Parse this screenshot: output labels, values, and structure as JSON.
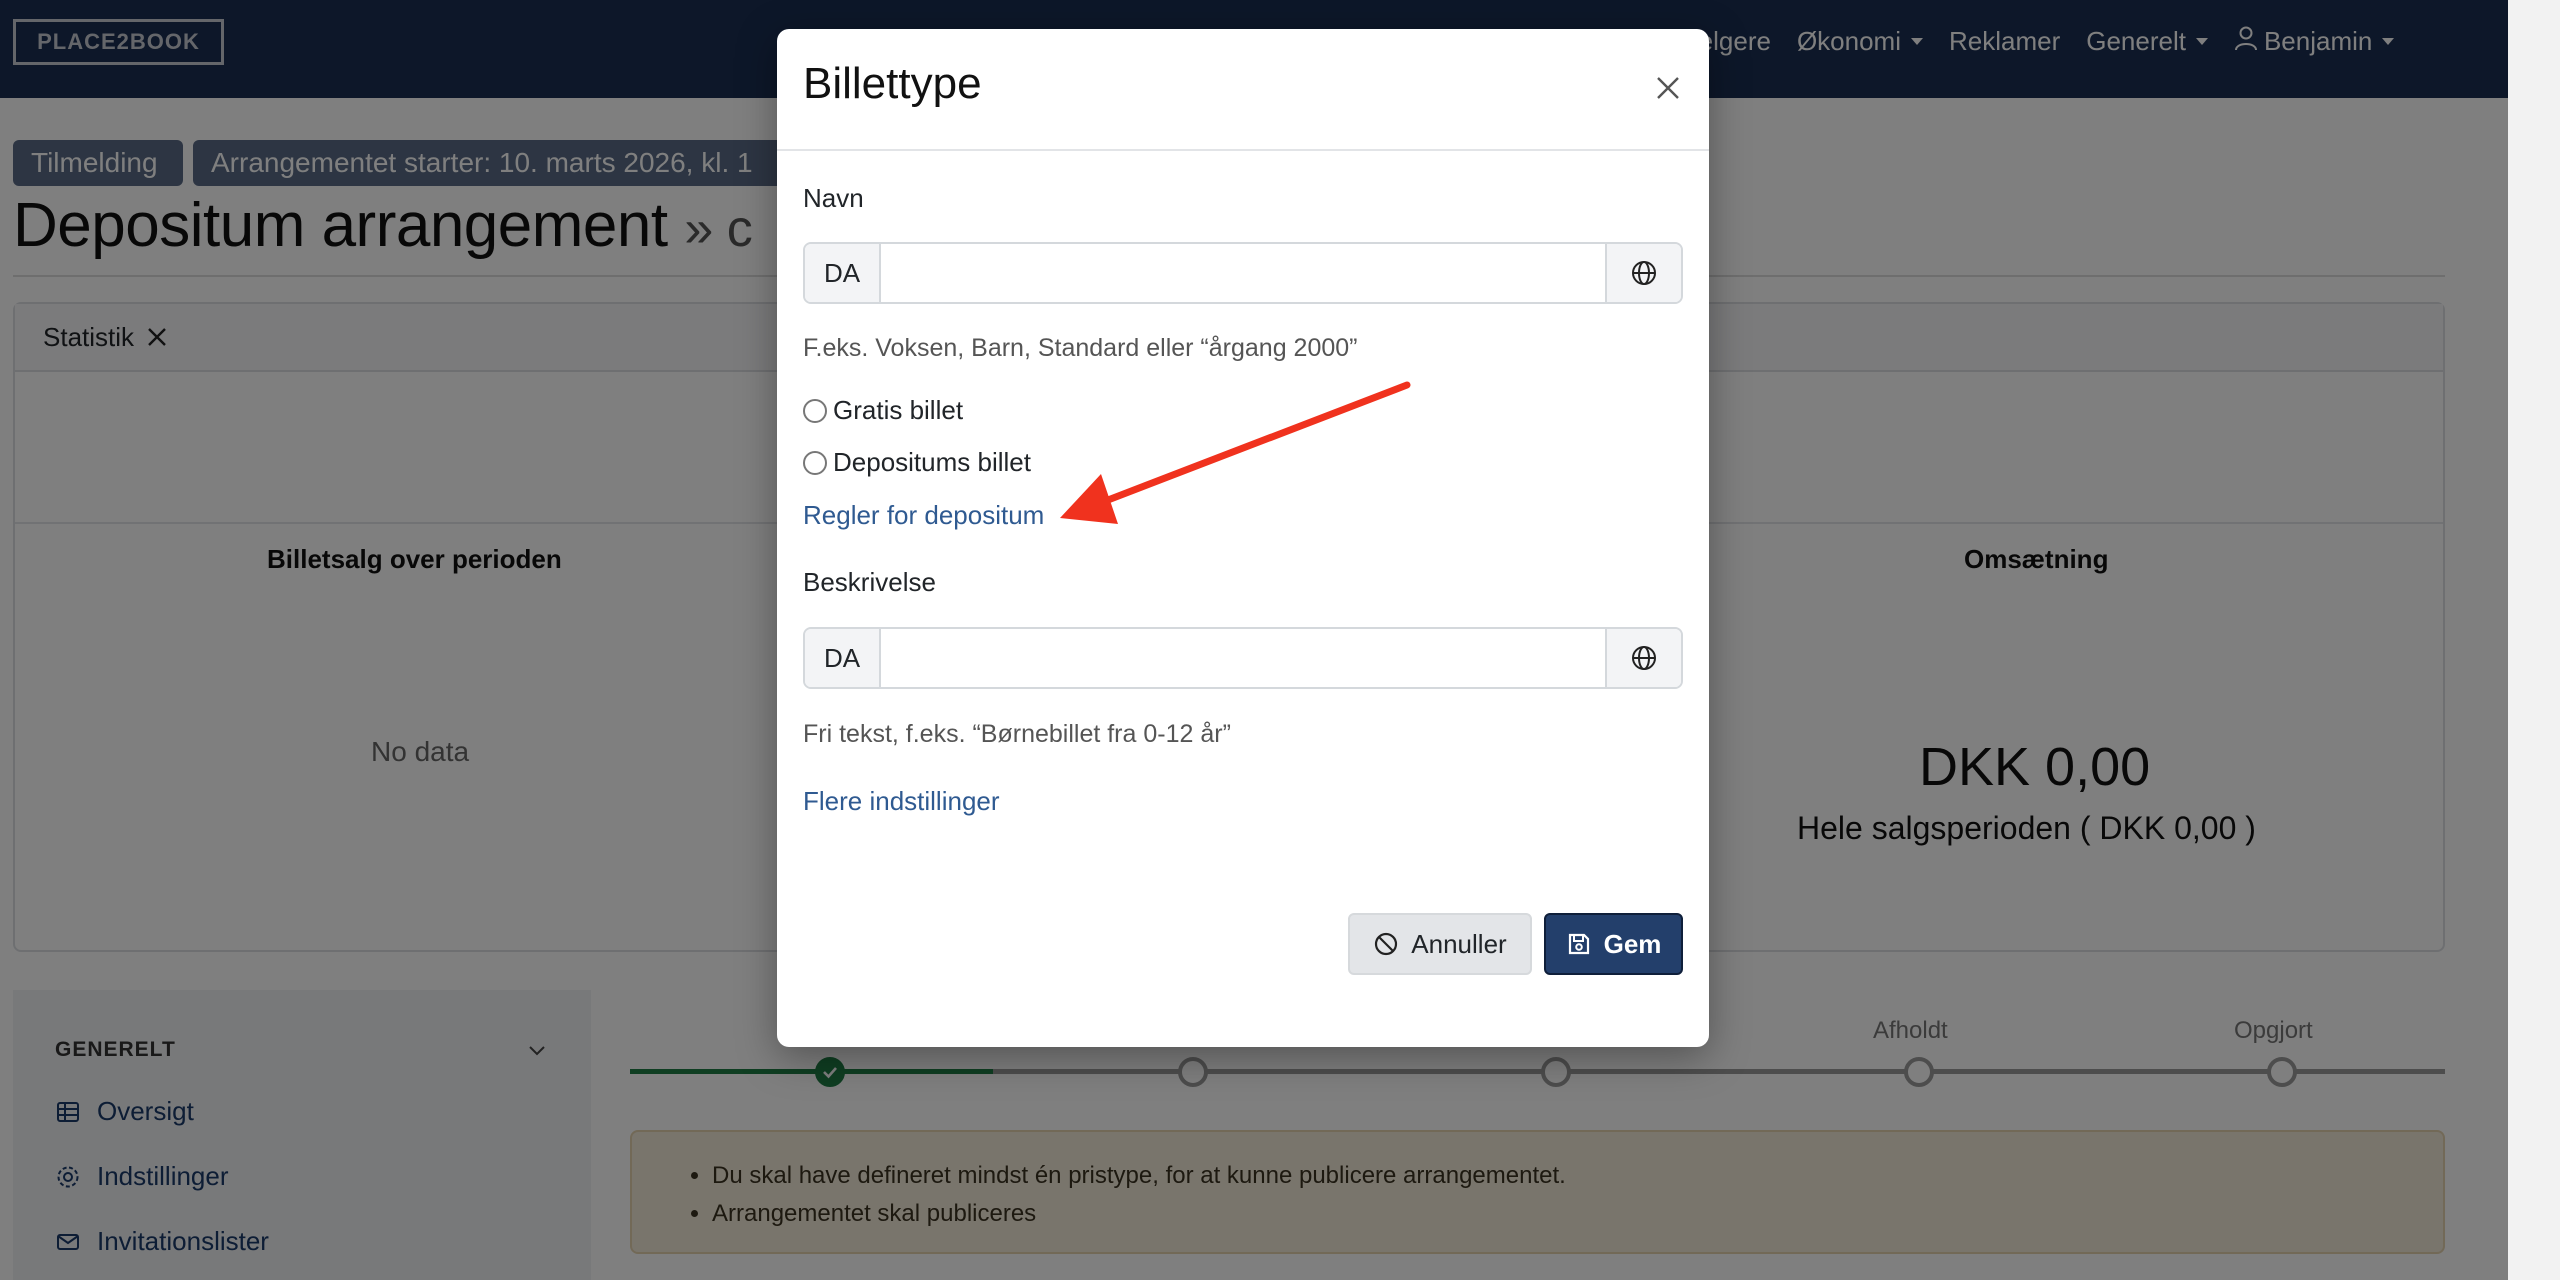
{
  "navbar": {
    "logo_text": "PLACE2BOOK",
    "items": [
      {
        "label": "ælgere",
        "has_caret": false
      },
      {
        "label": "Økonomi",
        "has_caret": true
      },
      {
        "label": "Reklamer",
        "has_caret": false
      },
      {
        "label": "Generelt",
        "has_caret": true
      },
      {
        "label": "Benjamin",
        "has_caret": true,
        "icon": "user-icon"
      }
    ]
  },
  "badges": {
    "registration": "Tilmelding",
    "event_start": "Arrangementet starter: 10. marts 2026, kl. 1"
  },
  "page": {
    "title": "Depositum arrangement",
    "title_suffix": "» c"
  },
  "statistics": {
    "header_label": "Statistik",
    "ticket_sales_title": "Billetsalg over perioden",
    "ticket_sales_empty": "No data",
    "revenue_title": "Omsætning",
    "revenue_amount": "DKK 0,00",
    "revenue_period": "Hele salgsperioden ( DKK 0,00 )"
  },
  "sidebar": {
    "heading": "GENERELT",
    "items": [
      {
        "label": "Oversigt",
        "icon": "table-icon"
      },
      {
        "label": "Indstillinger",
        "icon": "gear-icon"
      },
      {
        "label": "Invitationslister",
        "icon": "envelope-icon"
      }
    ]
  },
  "progress": {
    "steps": [
      {
        "label": "",
        "done": true
      },
      {
        "label": "",
        "done": false
      },
      {
        "label": "",
        "done": false
      },
      {
        "label": "Afholdt",
        "done": false
      },
      {
        "label": "Opgjort",
        "done": false
      }
    ],
    "completed_fraction": 0.2
  },
  "alert": {
    "items": [
      "Du skal have defineret mindst én pristype, for at kunne publicere arrangementet.",
      "Arrangementet skal publiceres"
    ]
  },
  "modal": {
    "title": "Billettype",
    "name_label": "Navn",
    "name_lang": "DA",
    "name_value": "",
    "name_help": "F.eks. Voksen, Barn, Standard eller “årgang 2000”",
    "free_ticket_label": "Gratis billet",
    "deposit_ticket_label": "Depositums billet",
    "deposit_rules_link": "Regler for depositum",
    "description_label": "Beskrivelse",
    "description_lang": "DA",
    "description_value": "",
    "description_help": "Fri tekst, f.eks. “Børnebillet fra 0-12 år”",
    "more_settings_link": "Flere indstillinger",
    "cancel_label": "Annuller",
    "save_label": "Gem"
  },
  "colors": {
    "navbar": "#1b2f52",
    "primary_button": "#233f6b",
    "link": "#2f5a91",
    "progress_done": "#1e7d45",
    "annotation_arrow": "#f0321e",
    "alert_bg": "#f3ead9"
  }
}
